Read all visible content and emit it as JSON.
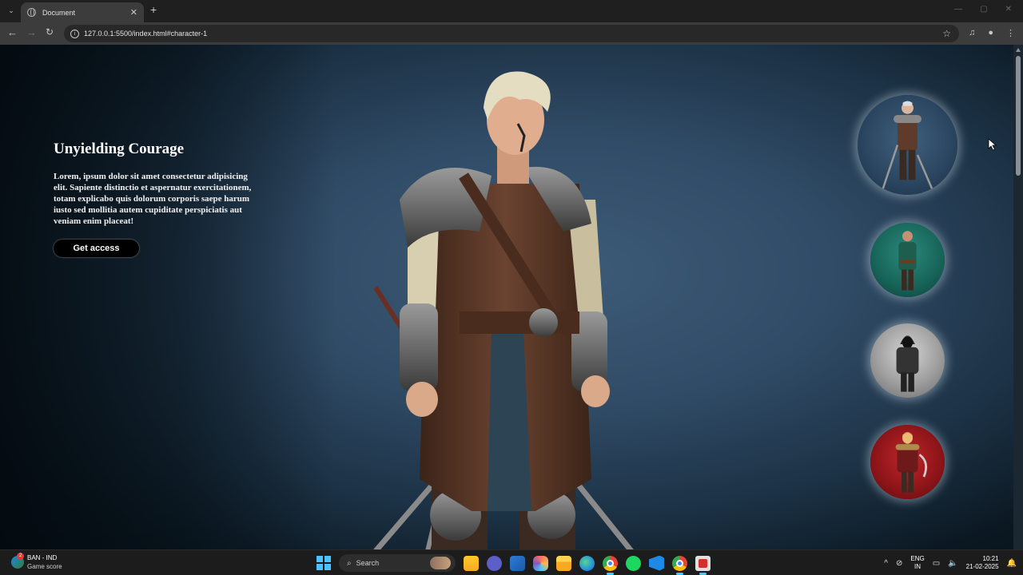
{
  "browser": {
    "tab_title": "Document",
    "url": "127.0.0.1:5500/index.html#character-1"
  },
  "hero": {
    "title": "Unyielding Courage",
    "description": "Lorem, ipsum dolor sit amet consectetur adipisicing elit. Sapiente distinctio et aspernatur exercitationem, totam explicabo quis dolorum corporis saepe harum iusto sed mollitia autem cupiditate perspiciatis aut veniam enim placeat!",
    "cta_label": "Get access"
  },
  "characters": [
    {
      "id": "character-1",
      "accent": "#2a4560",
      "icon": "armored-warrior"
    },
    {
      "id": "character-2",
      "accent": "#176358",
      "icon": "bald-green-warrior"
    },
    {
      "id": "character-3",
      "accent": "#9e9e9e",
      "icon": "hooded-assassin"
    },
    {
      "id": "character-4",
      "accent": "#8c1418",
      "icon": "red-barbarian"
    }
  ],
  "taskbar": {
    "weather_title": "BAN - IND",
    "weather_sub": "Game score",
    "weather_badge": "2",
    "search_label": "Search",
    "lang_top": "ENG",
    "lang_bottom": "IN",
    "time": "10:21",
    "date": "21-02-2025"
  },
  "colors": {
    "accent_taskbar": "#4cc2ff",
    "cta_bg": "#000000"
  }
}
